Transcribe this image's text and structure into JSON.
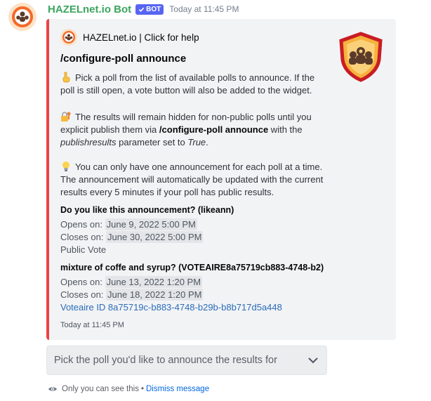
{
  "message": {
    "username": "HAZELnet.io Bot",
    "bot_tag": "BOT",
    "timestamp": "Today at 11:45 PM"
  },
  "embed": {
    "accent_color": "#ed4245",
    "author": "HAZELnet.io | Click for help",
    "title": "/configure-poll announce",
    "paragraphs": [
      {
        "emoji": "point-down-icon",
        "text": "Pick a poll from the list of available polls to announce. If the poll is still open, a vote button will also be added to the widget."
      },
      {
        "emoji": "lock-key-icon",
        "text_before": "The results will remain hidden for non-public polls until you explicit publish them via ",
        "bold": "/configure-poll announce",
        "text_mid": " with the ",
        "italic1": "publishresults",
        "text_after": " parameter set to ",
        "italic2": "True",
        "text_end": "."
      },
      {
        "emoji": "lightbulb-icon",
        "text": "You can only have one announcement for each poll at a time. The announcement will automatically be updated with the current results every 5 minutes if your poll has public results."
      }
    ],
    "fields": [
      {
        "name": "Do you like this announcement? (likeann)",
        "opens_label": "Opens on:",
        "opens_value": "June 9, 2022 5:00 PM",
        "closes_label": "Closes on:",
        "closes_value": "June 30, 2022 5:00 PM",
        "extra": "Public Vote"
      },
      {
        "name": "mixture of coffe and syrup? (VOTEAIRE8a75719cb883-4748-b2)",
        "opens_label": "Opens on:",
        "opens_value": "June 13, 2022 1:20 PM",
        "closes_label": "Closes on:",
        "closes_value": "June 18, 2022 1:20 PM",
        "extra": "Voteaire ID 8a75719c-b883-4748-b29b-b8b717d5a448"
      }
    ],
    "footer": "Today at 11:45 PM"
  },
  "select": {
    "placeholder": "Pick the poll you'd like to announce the results for"
  },
  "ephemeral": {
    "text": "Only you can see this",
    "separator": "•",
    "dismiss": "Dismiss message"
  }
}
